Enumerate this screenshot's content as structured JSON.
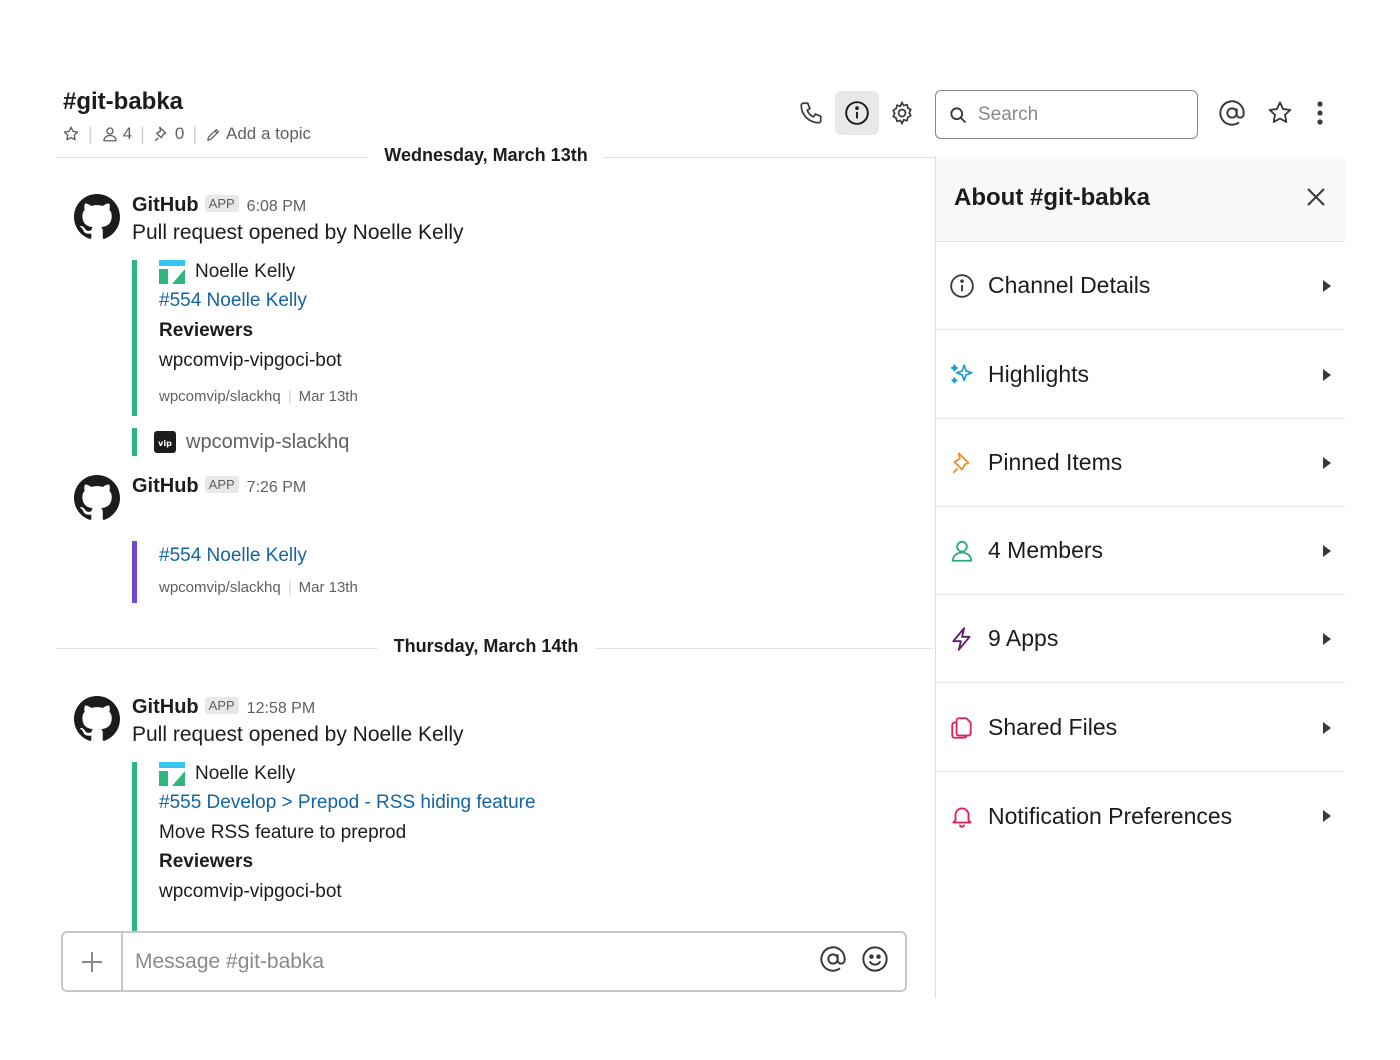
{
  "header": {
    "channel_title": "#git-babka",
    "members_count": "4",
    "pinned_count": "0",
    "add_topic_label": "Add a topic",
    "search_placeholder": "Search"
  },
  "dividers": [
    {
      "label": "Wednesday, March 13th"
    },
    {
      "label": "Thursday, March 14th"
    }
  ],
  "messages": [
    {
      "sender": "GitHub",
      "badge": "APP",
      "time": "6:08 PM",
      "text": "Pull request opened by Noelle Kelly",
      "attachment": {
        "author": "Noelle Kelly",
        "link": "#554 Noelle Kelly",
        "field_title": "Reviewers",
        "field_value": "wpcomvip-vipgoci-bot",
        "footer_repo": "wpcomvip/slackhq",
        "footer_date": "Mar 13th"
      },
      "extension": "wpcomvip-slackhq"
    },
    {
      "sender": "GitHub",
      "badge": "APP",
      "time": "7:26 PM",
      "attachment": {
        "link": "#554 Noelle Kelly",
        "footer_repo": "wpcomvip/slackhq",
        "footer_date": "Mar 13th"
      }
    },
    {
      "sender": "GitHub",
      "badge": "APP",
      "time": "12:58 PM",
      "text": "Pull request opened by Noelle Kelly",
      "attachment": {
        "author": "Noelle Kelly",
        "link": "#555 Develop > Prepod - RSS hiding feature",
        "description": "Move RSS feature to preprod",
        "field_title": "Reviewers",
        "field_value": "wpcomvip-vipgoci-bot"
      }
    }
  ],
  "composer": {
    "placeholder": "Message #git-babka"
  },
  "panel": {
    "title": "About #git-babka",
    "items": [
      {
        "label": "Channel Details",
        "icon": "info-icon"
      },
      {
        "label": "Highlights",
        "icon": "sparkle-icon"
      },
      {
        "label": "Pinned Items",
        "icon": "pin-icon"
      },
      {
        "label": "4 Members",
        "icon": "person-icon"
      },
      {
        "label": "9 Apps",
        "icon": "bolt-icon"
      },
      {
        "label": "Shared Files",
        "icon": "files-icon"
      },
      {
        "label": "Notification Preferences",
        "icon": "bell-icon"
      }
    ]
  },
  "colors": {
    "green_bar": "#2eb67d",
    "purple_bar": "#6e4ad6",
    "link": "#1264a3",
    "highlights_icon": "#1d9bd1",
    "pinned_icon": "#e8912d",
    "members_icon": "#2bac76",
    "apps_icon": "#611f69",
    "files_icon": "#e01e5a",
    "notification_icon": "#e01e5a"
  }
}
